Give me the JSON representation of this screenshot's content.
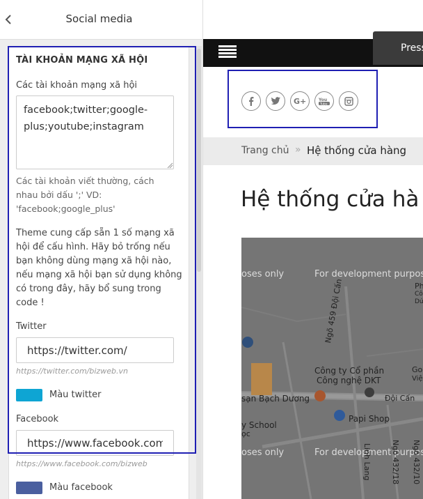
{
  "customizer": {
    "header_title": "Social media",
    "section_heading": "TÀI KHOẢN MẠNG XÃ HỘI",
    "accounts_label": "Các tài khoản mạng xã hội",
    "accounts_value": "facebook;twitter;google-plus;youtube;instagram",
    "accounts_hint": [
      "Các tài khoản viết thường, cách",
      "nhau bởi dấu ';' VD:",
      "'facebook;google_plus'"
    ],
    "theme_note": [
      "Theme cung cấp sẵn 1 số mạng xã",
      "hội để cấu hình. Hãy bỏ trống nếu",
      "bạn không dùng mạng xã hội nào,",
      "nếu mạng xã hội bạn sử dụng không",
      "có trong đây, hãy bổ sung trong",
      "code !"
    ],
    "twitter_label": "Twitter",
    "twitter_value": "https://twitter.com/",
    "twitter_placeholder": "https://twitter.com/bizweb.vn",
    "twitter_color_label": "Màu twitter",
    "twitter_color": "#0ea5d3",
    "facebook_label": "Facebook",
    "facebook_value": "https://www.facebook.com/",
    "facebook_placeholder": "https://www.facebook.com/bizweb",
    "facebook_color_label": "Màu facebook",
    "facebook_color": "#4a5f9f"
  },
  "preview": {
    "press_text": "Press",
    "social_icons": [
      "facebook-icon",
      "twitter-icon",
      "google-plus-icon",
      "youtube-icon",
      "instagram-icon"
    ],
    "breadcrumb_home": "Trang chủ",
    "breadcrumb_sep": "»",
    "breadcrumb_current": "Hệ thống cửa hàng",
    "page_title": "Hệ thống cửa hà",
    "map": {
      "dev_text_1a": "oses only",
      "dev_text_1b": "For development purpos",
      "dev_text_2a": "oses only",
      "dev_text_2b": "For development purpos",
      "road_1": "Ngõ 459 Đội Cấn",
      "place_1": "Công ty Cổ phần",
      "place_1b": "Công nghệ DKT",
      "place_2": "sạn Bạch Dương",
      "place_3": "Đội Cấn",
      "place_4": "Papi Shop",
      "place_5": "y School",
      "place_6": "ọc",
      "road_2": "Linh Lang",
      "road_3": "Ngõ 432/18",
      "road_4": "Ngõ 432/10",
      "edge_1": "Ph",
      "edge_2": "Cô",
      "edge_3": "Dứ",
      "edge_4": "Go",
      "edge_5": "Việ"
    },
    "accent_highlight": "#1f1fb3"
  }
}
